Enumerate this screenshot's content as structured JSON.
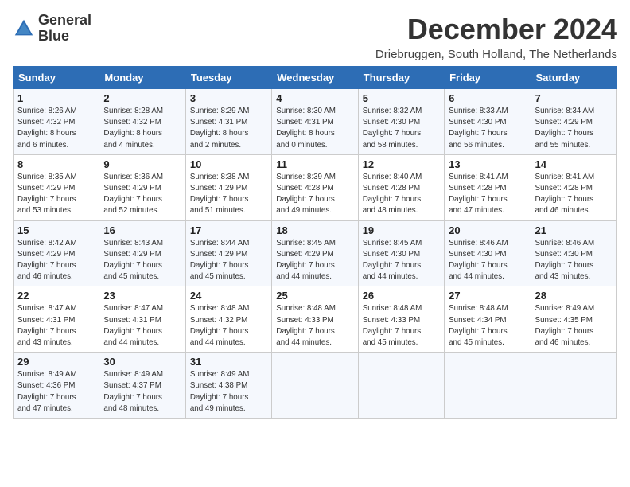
{
  "logo": {
    "line1": "General",
    "line2": "Blue"
  },
  "title": "December 2024",
  "location": "Driebruggen, South Holland, The Netherlands",
  "days_of_week": [
    "Sunday",
    "Monday",
    "Tuesday",
    "Wednesday",
    "Thursday",
    "Friday",
    "Saturday"
  ],
  "weeks": [
    [
      {
        "day": 1,
        "sunrise": "8:26 AM",
        "sunset": "4:32 PM",
        "daylight": "8 hours and 6 minutes."
      },
      {
        "day": 2,
        "sunrise": "8:28 AM",
        "sunset": "4:32 PM",
        "daylight": "8 hours and 4 minutes."
      },
      {
        "day": 3,
        "sunrise": "8:29 AM",
        "sunset": "4:31 PM",
        "daylight": "8 hours and 2 minutes."
      },
      {
        "day": 4,
        "sunrise": "8:30 AM",
        "sunset": "4:31 PM",
        "daylight": "8 hours and 0 minutes."
      },
      {
        "day": 5,
        "sunrise": "8:32 AM",
        "sunset": "4:30 PM",
        "daylight": "7 hours and 58 minutes."
      },
      {
        "day": 6,
        "sunrise": "8:33 AM",
        "sunset": "4:30 PM",
        "daylight": "7 hours and 56 minutes."
      },
      {
        "day": 7,
        "sunrise": "8:34 AM",
        "sunset": "4:29 PM",
        "daylight": "7 hours and 55 minutes."
      }
    ],
    [
      {
        "day": 8,
        "sunrise": "8:35 AM",
        "sunset": "4:29 PM",
        "daylight": "7 hours and 53 minutes."
      },
      {
        "day": 9,
        "sunrise": "8:36 AM",
        "sunset": "4:29 PM",
        "daylight": "7 hours and 52 minutes."
      },
      {
        "day": 10,
        "sunrise": "8:38 AM",
        "sunset": "4:29 PM",
        "daylight": "7 hours and 51 minutes."
      },
      {
        "day": 11,
        "sunrise": "8:39 AM",
        "sunset": "4:28 PM",
        "daylight": "7 hours and 49 minutes."
      },
      {
        "day": 12,
        "sunrise": "8:40 AM",
        "sunset": "4:28 PM",
        "daylight": "7 hours and 48 minutes."
      },
      {
        "day": 13,
        "sunrise": "8:41 AM",
        "sunset": "4:28 PM",
        "daylight": "7 hours and 47 minutes."
      },
      {
        "day": 14,
        "sunrise": "8:41 AM",
        "sunset": "4:28 PM",
        "daylight": "7 hours and 46 minutes."
      }
    ],
    [
      {
        "day": 15,
        "sunrise": "8:42 AM",
        "sunset": "4:29 PM",
        "daylight": "7 hours and 46 minutes."
      },
      {
        "day": 16,
        "sunrise": "8:43 AM",
        "sunset": "4:29 PM",
        "daylight": "7 hours and 45 minutes."
      },
      {
        "day": 17,
        "sunrise": "8:44 AM",
        "sunset": "4:29 PM",
        "daylight": "7 hours and 45 minutes."
      },
      {
        "day": 18,
        "sunrise": "8:45 AM",
        "sunset": "4:29 PM",
        "daylight": "7 hours and 44 minutes."
      },
      {
        "day": 19,
        "sunrise": "8:45 AM",
        "sunset": "4:30 PM",
        "daylight": "7 hours and 44 minutes."
      },
      {
        "day": 20,
        "sunrise": "8:46 AM",
        "sunset": "4:30 PM",
        "daylight": "7 hours and 44 minutes."
      },
      {
        "day": 21,
        "sunrise": "8:46 AM",
        "sunset": "4:30 PM",
        "daylight": "7 hours and 43 minutes."
      }
    ],
    [
      {
        "day": 22,
        "sunrise": "8:47 AM",
        "sunset": "4:31 PM",
        "daylight": "7 hours and 43 minutes."
      },
      {
        "day": 23,
        "sunrise": "8:47 AM",
        "sunset": "4:31 PM",
        "daylight": "7 hours and 44 minutes."
      },
      {
        "day": 24,
        "sunrise": "8:48 AM",
        "sunset": "4:32 PM",
        "daylight": "7 hours and 44 minutes."
      },
      {
        "day": 25,
        "sunrise": "8:48 AM",
        "sunset": "4:33 PM",
        "daylight": "7 hours and 44 minutes."
      },
      {
        "day": 26,
        "sunrise": "8:48 AM",
        "sunset": "4:33 PM",
        "daylight": "7 hours and 45 minutes."
      },
      {
        "day": 27,
        "sunrise": "8:48 AM",
        "sunset": "4:34 PM",
        "daylight": "7 hours and 45 minutes."
      },
      {
        "day": 28,
        "sunrise": "8:49 AM",
        "sunset": "4:35 PM",
        "daylight": "7 hours and 46 minutes."
      }
    ],
    [
      {
        "day": 29,
        "sunrise": "8:49 AM",
        "sunset": "4:36 PM",
        "daylight": "7 hours and 47 minutes."
      },
      {
        "day": 30,
        "sunrise": "8:49 AM",
        "sunset": "4:37 PM",
        "daylight": "7 hours and 48 minutes."
      },
      {
        "day": 31,
        "sunrise": "8:49 AM",
        "sunset": "4:38 PM",
        "daylight": "7 hours and 49 minutes."
      },
      null,
      null,
      null,
      null
    ]
  ]
}
